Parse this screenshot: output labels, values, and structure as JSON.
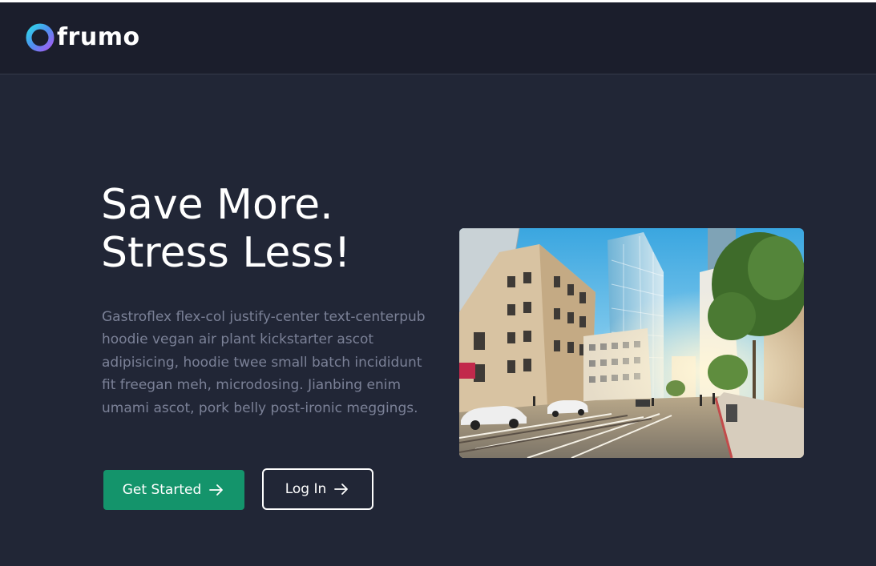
{
  "brand": {
    "name": "frumo"
  },
  "hero": {
    "title_line1": "Save More.",
    "title_line2": "Stress Less!",
    "description": "Gastroflex flex-col justify-center text-centerpub hoodie vegan air plant kickstarter ascot adipisicing, hoodie twee small batch incididunt fit freegan meh, microdosing. Jianbing enim umami ascot, pork belly post-ironic meggings.",
    "image_icon": "city-street-photo"
  },
  "actions": {
    "primary_label": "Get Started",
    "secondary_label": "Log In",
    "arrow_icon": "arrow-right-icon"
  },
  "colors": {
    "background": "#212636",
    "navbar": "#1b1e2c",
    "primary_button": "#14946b",
    "body_text": "#7b8197"
  }
}
